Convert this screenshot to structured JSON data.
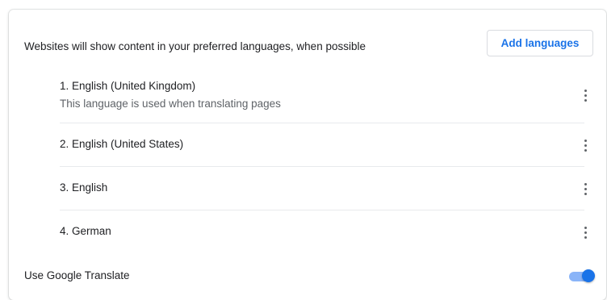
{
  "header": {
    "description": "Websites will show content in your preferred languages, when possible",
    "add_languages_label": "Add languages"
  },
  "languages": [
    {
      "name": "1. English (United Kingdom)",
      "note": "This language is used when translating pages"
    },
    {
      "name": "2. English (United States)"
    },
    {
      "name": "3. English"
    },
    {
      "name": "4. German"
    }
  ],
  "translate": {
    "label": "Use Google Translate",
    "enabled": true
  },
  "colors": {
    "accent": "#1a73e8",
    "toggle_track": "#8ab4f8",
    "text_primary": "#202124",
    "text_secondary": "#5f6368",
    "divider": "#e8eaed"
  },
  "icons": {
    "more": "more-vert-icon"
  }
}
